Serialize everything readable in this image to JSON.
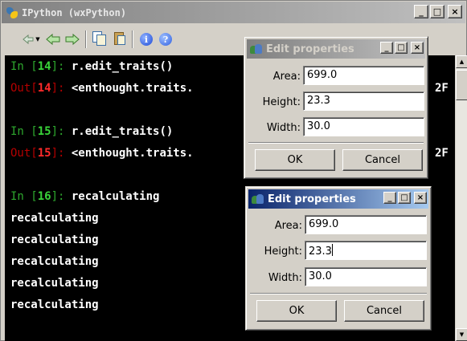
{
  "window": {
    "title": "IPython (wxPython)",
    "minimize": "_",
    "maximize": "□",
    "close": "×"
  },
  "toolbar": {
    "dropdown_glyph": "▼",
    "about_label": "i",
    "help_label": "?"
  },
  "console": {
    "lines": [
      {
        "prompt": "In [",
        "num": "14",
        "suffix": "]: ",
        "text": "r.edit_traits()",
        "kind": "in"
      },
      {
        "prompt": "Out[",
        "num": "14",
        "suffix": "]: ",
        "text": "<enthought.traits.",
        "kind": "out",
        "tail": "2F"
      },
      {
        "prompt": "",
        "num": "",
        "suffix": "",
        "text": "",
        "kind": "blank"
      },
      {
        "prompt": "In [",
        "num": "15",
        "suffix": "]: ",
        "text": "r.edit_traits()",
        "kind": "in"
      },
      {
        "prompt": "Out[",
        "num": "15",
        "suffix": "]: ",
        "text": "<enthought.traits.",
        "kind": "out",
        "tail": "2F"
      },
      {
        "prompt": "",
        "num": "",
        "suffix": "",
        "text": "",
        "kind": "blank"
      },
      {
        "prompt": "In [",
        "num": "16",
        "suffix": "]: ",
        "text": "recalculating",
        "kind": "in"
      },
      {
        "text": "recalculating",
        "kind": "plain"
      },
      {
        "text": "recalculating",
        "kind": "plain"
      },
      {
        "text": "recalculating",
        "kind": "plain"
      },
      {
        "text": "recalculating",
        "kind": "plain"
      },
      {
        "text": "recalculating",
        "kind": "plain"
      }
    ]
  },
  "dialog_back": {
    "title": "Edit properties",
    "area_label": "Area:",
    "area_value": "699.0",
    "height_label": "Height:",
    "height_value": "23.3",
    "width_label": "Width:",
    "width_value": "30.0",
    "ok": "OK",
    "cancel": "Cancel",
    "minimize": "_",
    "maximize": "□",
    "close": "×"
  },
  "dialog_front": {
    "title": "Edit properties",
    "area_label": "Area:",
    "area_value": "699.0",
    "height_label": "Height:",
    "height_value": "23.3",
    "width_label": "Width:",
    "width_value": "30.0",
    "ok": "OK",
    "cancel": "Cancel",
    "minimize": "_",
    "maximize": "□",
    "close": "×"
  },
  "scrollbar": {
    "up": "▲",
    "down": "▼"
  },
  "colors": {
    "prompt_in": "#2ea82e",
    "prompt_out": "#ff2a2a",
    "active_title": "#0a246a",
    "inactive_title": "#808080"
  }
}
